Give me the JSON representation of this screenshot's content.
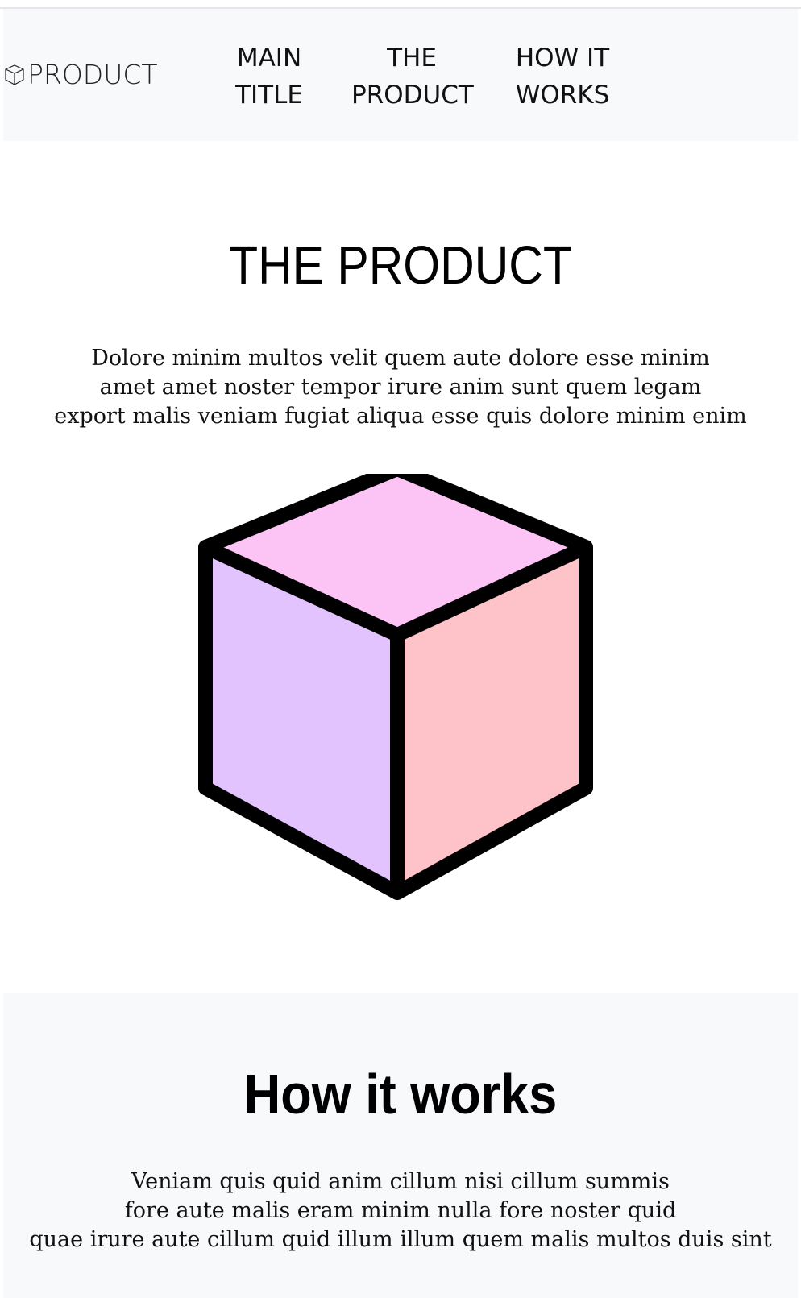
{
  "navbar": {
    "brand_icon": "cube-outline-icon",
    "brand_text": "PRODUCT",
    "links": [
      {
        "line1": "MAIN",
        "line2": "TITLE"
      },
      {
        "line1": "THE",
        "line2": "PRODUCT"
      },
      {
        "line1": "HOW IT",
        "line2": "WORKS"
      }
    ]
  },
  "hero": {
    "title": "THE PRODUCT",
    "paragraph_lines": [
      "Dolore minim multos velit quem aute dolore esse minim",
      "amet amet noster tempor irure anim sunt quem legam",
      "export malis veniam fugiat aliqua esse quis dolore minim enim"
    ],
    "illustration": "cube-icon",
    "colors": {
      "top_face": "#fcc3f5",
      "left_face": "#e2c3fd",
      "right_face": "#fec3c9",
      "outline": "#000000"
    }
  },
  "how_it_works": {
    "title": "How it works",
    "paragraph_lines": [
      "Veniam quis quid anim cillum nisi cillum summis",
      "fore aute malis eram minim nulla fore noster quid",
      "quae irure aute cillum quid illum illum quem malis multos duis sint"
    ]
  },
  "colors": {
    "section_background": "#f8f9fb",
    "page_background": "#ffffff"
  }
}
